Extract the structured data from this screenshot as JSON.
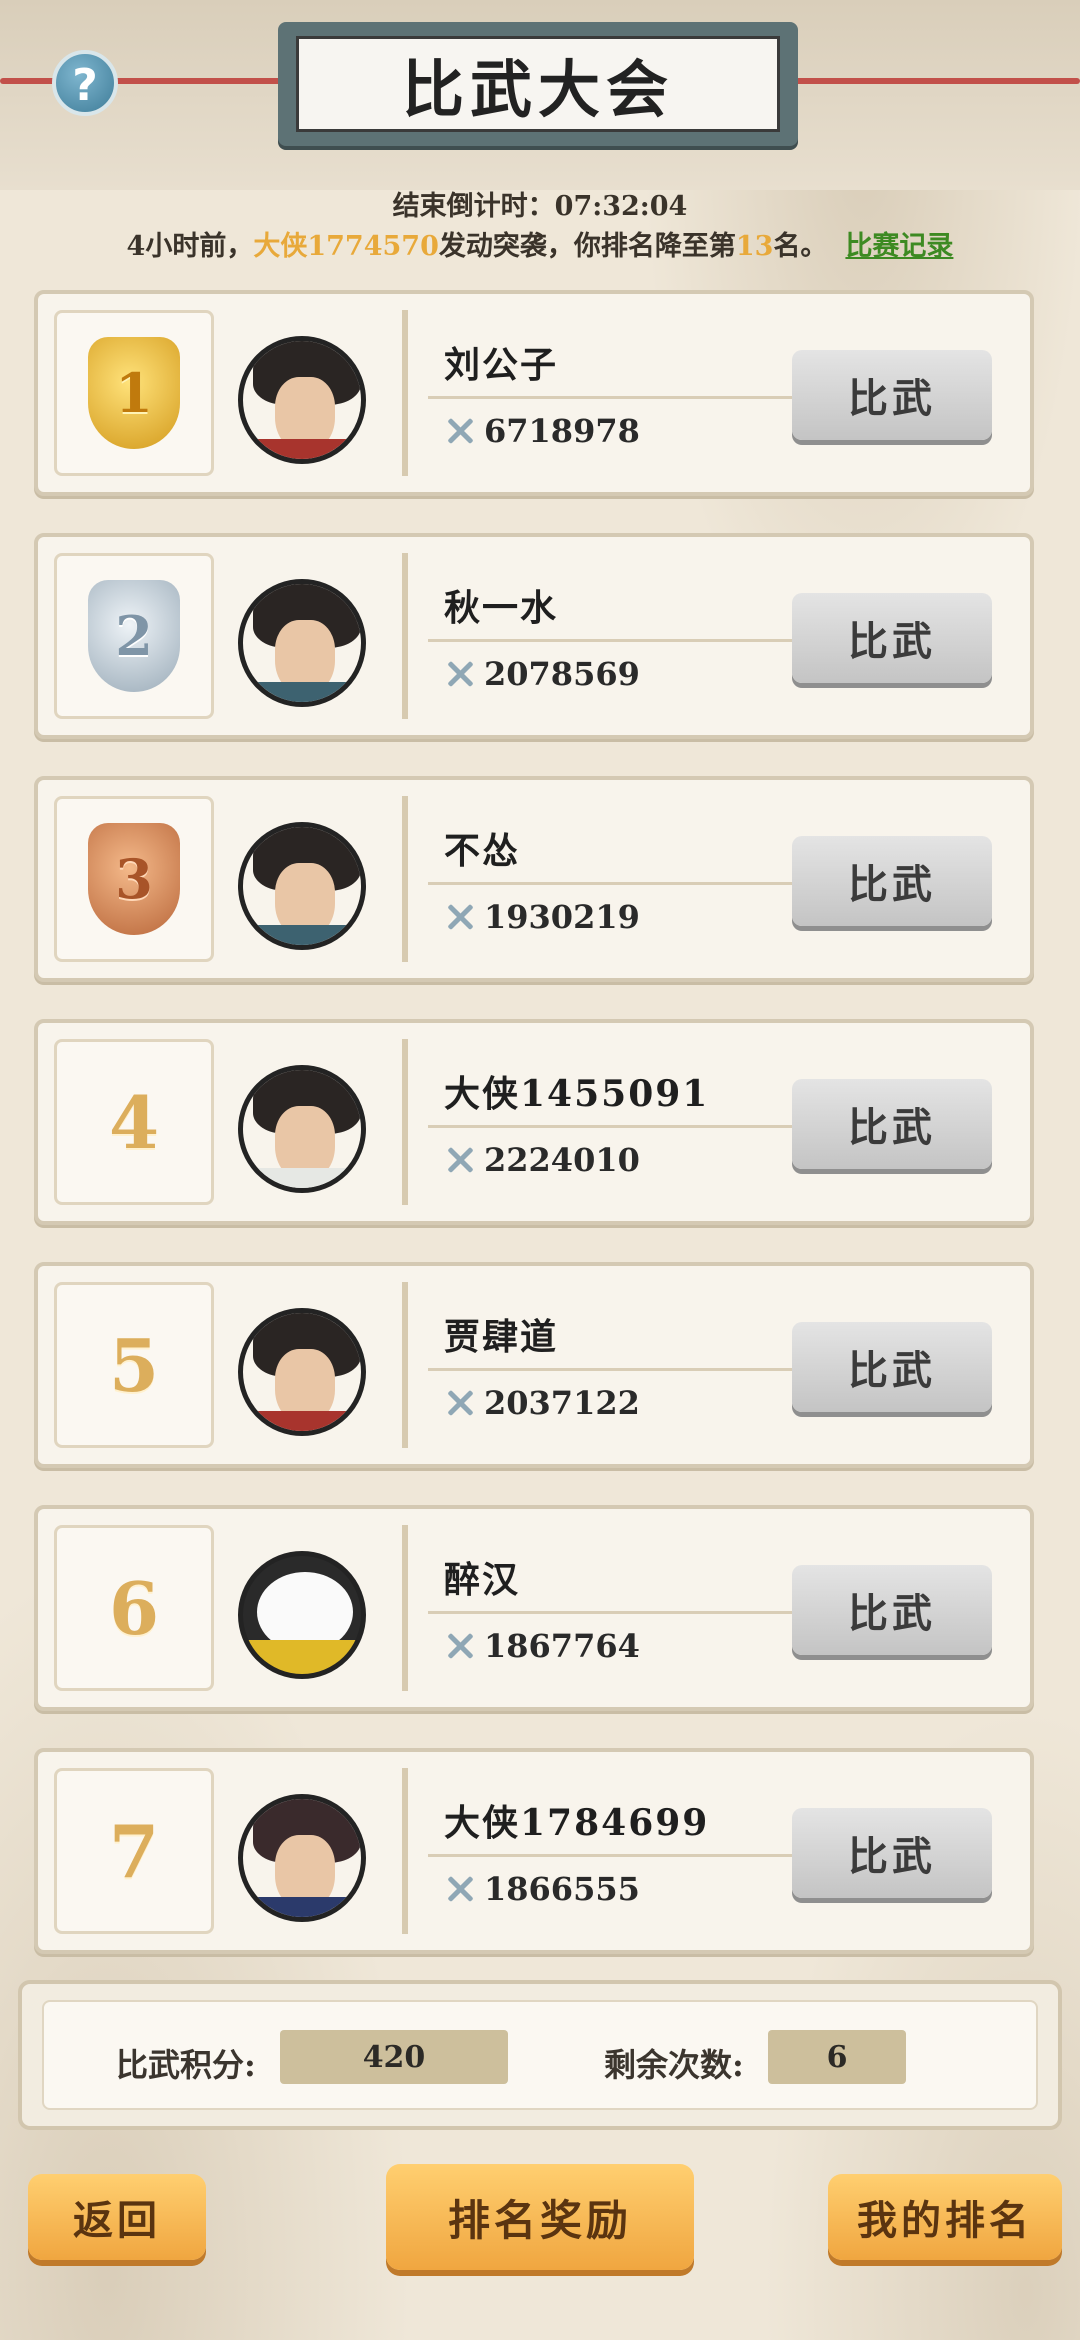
{
  "header": {
    "title": "比武大会",
    "help_icon": "?",
    "countdown_label": "结束倒计时：",
    "countdown_value": "07:32:04"
  },
  "notice": {
    "prefix": "4小时前，",
    "attacker": "大侠1774570",
    "middle": "发动突袭，你排名降至第",
    "rank": "13",
    "suffix": "名。",
    "record_link": "比赛记录"
  },
  "ranking": [
    {
      "rank": "1",
      "medal": "gold",
      "name": "刘公子",
      "power": "6718978",
      "button": "比武"
    },
    {
      "rank": "2",
      "medal": "silver",
      "name": "秋一水",
      "power": "2078569",
      "button": "比武"
    },
    {
      "rank": "3",
      "medal": "bronze",
      "name": "不怂",
      "power": "1930219",
      "button": "比武"
    },
    {
      "rank": "4",
      "name": "大侠1455091",
      "power": "2224010",
      "button": "比武"
    },
    {
      "rank": "5",
      "name": "贾肆道",
      "power": "2037122",
      "button": "比武"
    },
    {
      "rank": "6",
      "name": "醉汉",
      "power": "1867764",
      "button": "比武"
    },
    {
      "rank": "7",
      "name": "大侠1784699",
      "power": "1866555",
      "button": "比武"
    }
  ],
  "stats": {
    "score_label": "比武积分:",
    "score_value": "420",
    "remaining_label": "剩余次数:",
    "remaining_value": "6"
  },
  "footer": {
    "back": "返回",
    "reward": "排名奖励",
    "my_rank": "我的排名"
  },
  "colors": {
    "accent_gold": "#e8a93a",
    "link_green": "#3d8a22",
    "button_orange": "#f0a640"
  }
}
